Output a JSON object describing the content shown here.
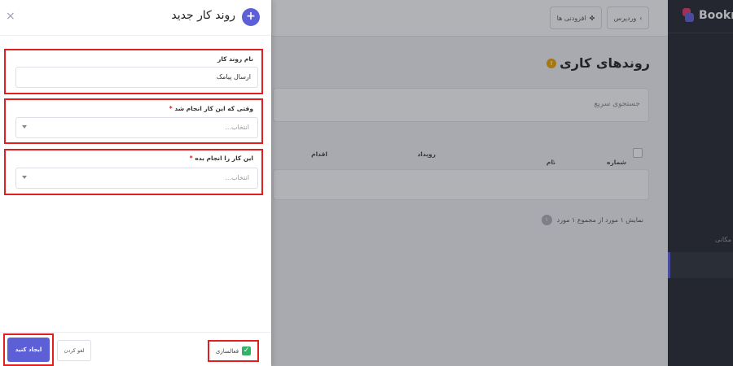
{
  "background": {
    "top_buttons": [
      {
        "label": "وردپرس",
        "icon": "chevron-right-icon"
      },
      {
        "label": "افزودنی ها",
        "icon": "puzzle-icon"
      }
    ],
    "page_title": "روندهای کاری",
    "title_badge": "!",
    "search_placeholder": "جستجوی سریع",
    "table_headers": {
      "number": "شماره",
      "number_sort": "⌄",
      "name": "نام",
      "name_sort": "⇕",
      "event": "رویداد",
      "action": "اقدام"
    },
    "footer_text": "نمایش ۱ مورد از مجموع ۱ مورد",
    "page_number": "۱"
  },
  "sidebar": {
    "brand": "Bookn",
    "item_text": "مکانی"
  },
  "drawer": {
    "title": "روند کار جدید",
    "plus": "+",
    "close": "×",
    "fields": {
      "name_label": "نام روند کار",
      "name_value": "ارسال پیامک",
      "trigger_label": "وقتی که این کار انجام شد",
      "trigger_placeholder": "انتخاب...",
      "action_label": "این کار را انجام بده",
      "action_placeholder": "انتخاب...",
      "required_mark": "*"
    },
    "footer": {
      "create_label": "ایجاد کنید",
      "cancel_label": "لغو کردن",
      "active_label": "فعالسازی",
      "active_check": "✓"
    }
  },
  "colors": {
    "accent": "#5c5fd6",
    "highlight": "#e02020",
    "success": "#34b26a"
  }
}
